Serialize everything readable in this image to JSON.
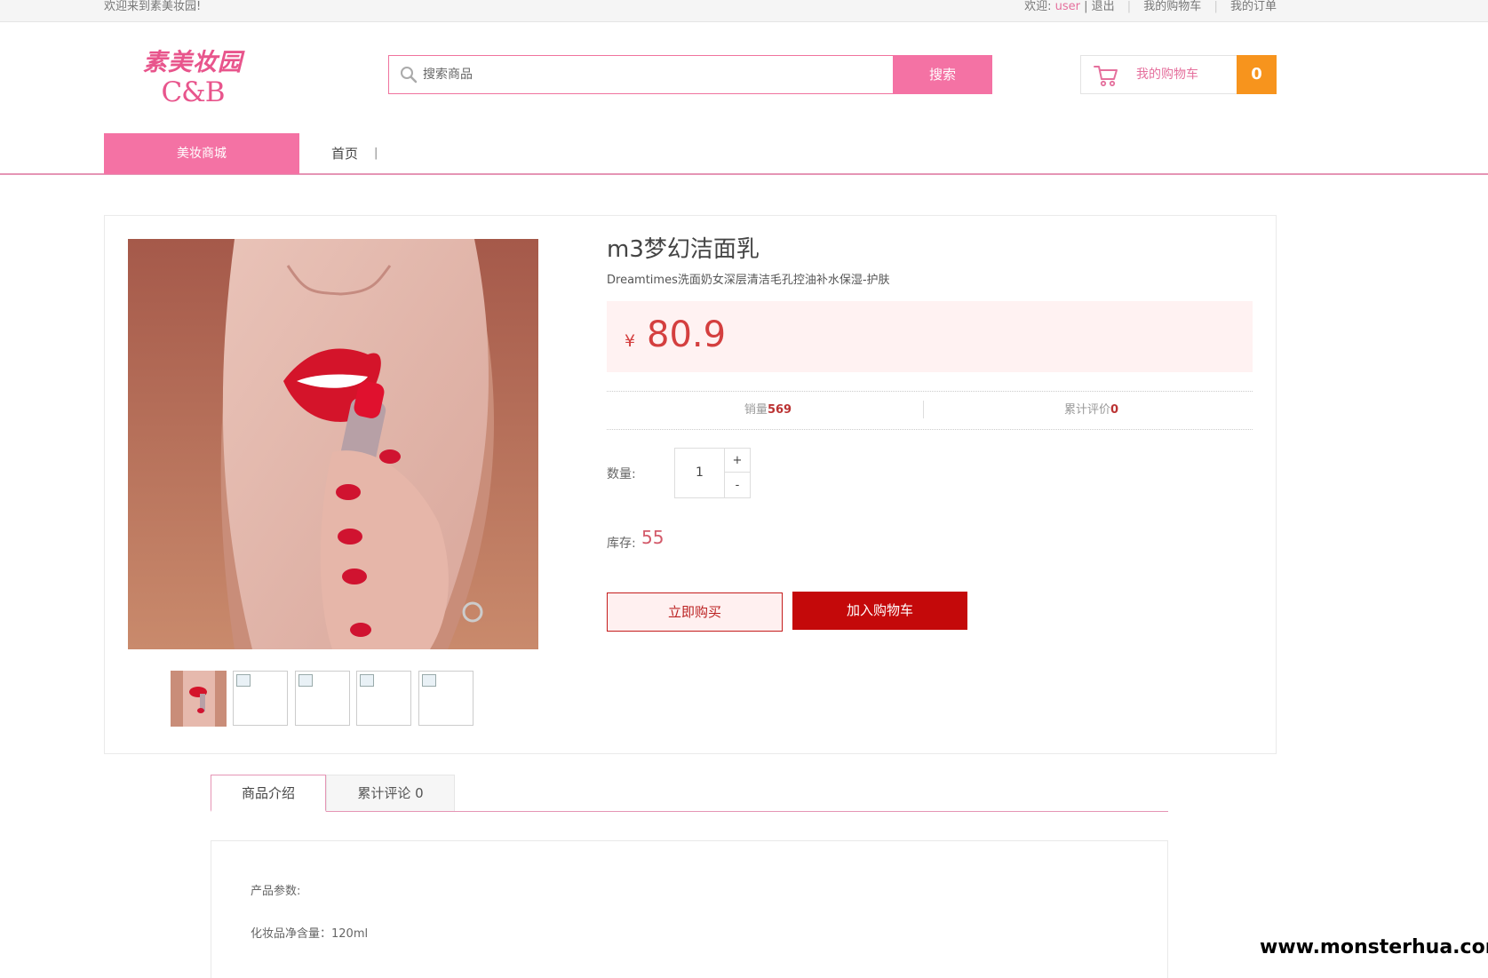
{
  "topbar": {
    "welcome": "欢迎来到素美妆园!",
    "greeting": "欢迎:",
    "username": "user",
    "logout": "| 退出",
    "my_cart": "我的购物车",
    "my_orders": "我的订单"
  },
  "logo": {
    "cn": "素美妆园",
    "en": "C&B"
  },
  "search": {
    "placeholder": "搜索商品",
    "button": "搜索"
  },
  "cart": {
    "label": "我的购物车",
    "count": "0"
  },
  "nav": {
    "category": "美妆商城",
    "home": "首页",
    "divider": "|"
  },
  "product": {
    "title": "m3梦幻洁面乳",
    "subtitle": "Dreamtimes洗面奶女深层清洁毛孔控油补水保湿-护肤",
    "currency": "¥",
    "price": "80.9",
    "sales_label": "销量",
    "sales": "569",
    "reviews_label": "累计评价",
    "reviews": "0",
    "qty_label": "数量:",
    "qty": "1",
    "plus": "+",
    "minus": "-",
    "stock_label": "库存:",
    "stock": "55",
    "buy_now": "立即购买",
    "add_to_cart": "加入购物车"
  },
  "tabs": [
    {
      "label": "商品介绍"
    },
    {
      "label": "累计评论 0"
    }
  ],
  "description": {
    "param_title": "产品参数:",
    "net_content": "化妆品净含量：120ml"
  },
  "watermark": "www.monsterhua.com",
  "colors": {
    "brand_pink": "#f472a4",
    "price_red": "#d43f3f",
    "cart_orange": "#f7941d",
    "add_cart_red": "#c4090a"
  },
  "icons": {
    "search": "search-icon",
    "cart": "cart-icon"
  }
}
